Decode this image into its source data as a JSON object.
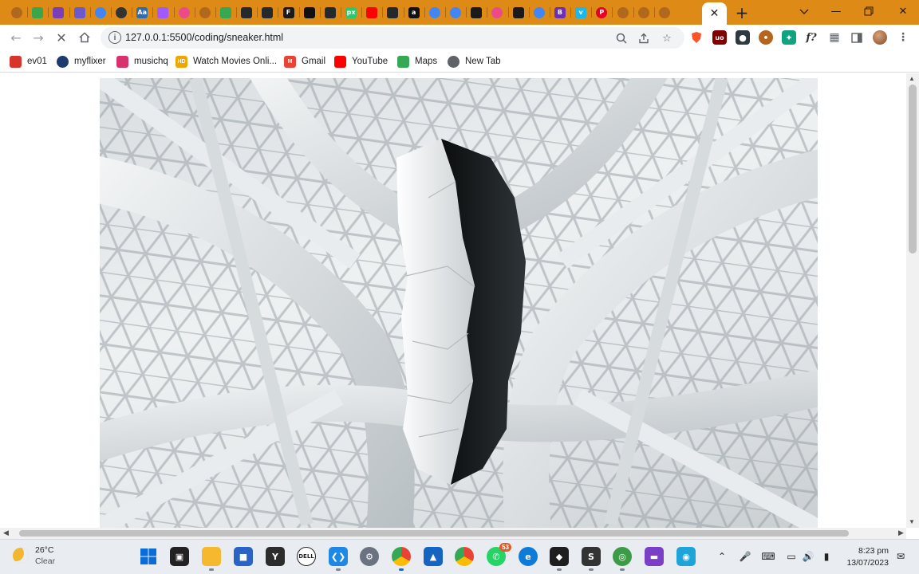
{
  "browser": {
    "tabs": [
      {
        "icon": "gear-icon",
        "color": "#b0681c"
      },
      {
        "icon": "diamond-icon",
        "color": "#39a649"
      },
      {
        "icon": "cat-icon",
        "color": "#7a3fb6"
      },
      {
        "icon": "prism-icon",
        "color": "#6a5acd"
      },
      {
        "icon": "google-icon",
        "color": "#4285f4"
      },
      {
        "icon": "chatgpt-icon",
        "color": "#333333"
      },
      {
        "icon": "dictionary-icon",
        "color": "#2d6cb3",
        "text": "Aa"
      },
      {
        "icon": "figma-icon",
        "color": "#a259ff"
      },
      {
        "icon": "dribbble-icon",
        "color": "#ea4c89"
      },
      {
        "icon": "gear-icon",
        "color": "#b0681c"
      },
      {
        "icon": "maps-pin-icon",
        "color": "#34a853"
      },
      {
        "icon": "github-icon",
        "color": "#24292e"
      },
      {
        "icon": "github-icon",
        "color": "#24292e"
      },
      {
        "icon": "f-icon",
        "color": "#1a1a1a",
        "text": "F"
      },
      {
        "icon": "codepen-icon",
        "color": "#111111"
      },
      {
        "icon": "github-icon",
        "color": "#24292e"
      },
      {
        "icon": "pixabay-icon",
        "color": "#2ec66e",
        "text": "px"
      },
      {
        "icon": "youtube-icon",
        "color": "#ff0000"
      },
      {
        "icon": "github-icon",
        "color": "#24292e"
      },
      {
        "icon": "a-icon",
        "color": "#111111",
        "text": "a"
      },
      {
        "icon": "google-icon",
        "color": "#4285f4"
      },
      {
        "icon": "google-icon",
        "color": "#4285f4"
      },
      {
        "icon": "dash-icon",
        "color": "#1a1a1a"
      },
      {
        "icon": "dribbble-icon",
        "color": "#ea4c89"
      },
      {
        "icon": "box-icon",
        "color": "#1a1a1a"
      },
      {
        "icon": "google-icon",
        "color": "#4285f4"
      },
      {
        "icon": "b-icon",
        "color": "#6c2fb5",
        "text": "B"
      },
      {
        "icon": "vimeo-icon",
        "color": "#1ab7ea",
        "text": "v"
      },
      {
        "icon": "pinterest-icon",
        "color": "#e60023",
        "text": "P"
      },
      {
        "icon": "gear-icon",
        "color": "#b0681c"
      },
      {
        "icon": "gear-icon",
        "color": "#b0681c"
      },
      {
        "icon": "gear-icon",
        "color": "#b0681c"
      }
    ],
    "active_tab_close": "✕",
    "new_tab": "+",
    "url": "127.0.0.1:5500/coding/sneaker.html",
    "accent": "#de8a17"
  },
  "bookmarks": [
    {
      "label": "ev01",
      "icon": "play-icon",
      "color": "#d9342b"
    },
    {
      "label": "myflixer",
      "icon": "film-icon",
      "color": "#1d3a6e"
    },
    {
      "label": "musichq",
      "icon": "play-icon",
      "color": "#d6336c"
    },
    {
      "label": "Watch Movies Onli...",
      "icon": "hd-icon",
      "color": "#f0a500",
      "text": "HD"
    },
    {
      "label": "Gmail",
      "icon": "gmail-icon",
      "color": "#ea4335",
      "text": "M"
    },
    {
      "label": "YouTube",
      "icon": "youtube-icon",
      "color": "#ff0000"
    },
    {
      "label": "Maps",
      "icon": "maps-icon",
      "color": "#34a853"
    },
    {
      "label": "New Tab",
      "icon": "globe-icon",
      "color": "#5f6368"
    }
  ],
  "taskbar": {
    "weather_temp": "26°C",
    "weather_cond": "Clear",
    "whatsapp_badge": "53",
    "time": "8:23 pm",
    "date": "13/07/2023"
  }
}
